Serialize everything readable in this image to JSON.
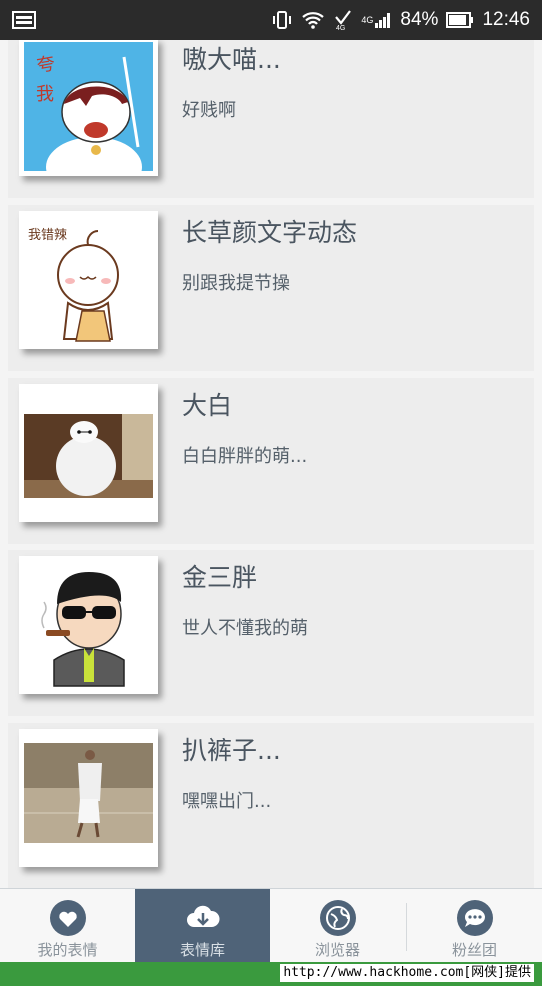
{
  "status_bar": {
    "network": "4G",
    "battery": "84%",
    "time": "12:46"
  },
  "items": [
    {
      "title": "嗷大喵...",
      "subtitle": "好贱啊"
    },
    {
      "title": "长草颜文字动态",
      "subtitle": "别跟我提节操"
    },
    {
      "title": "大白",
      "subtitle": "白白胖胖的萌..."
    },
    {
      "title": "金三胖",
      "subtitle": "世人不懂我的萌"
    },
    {
      "title": "扒裤子...",
      "subtitle": "嘿嘿出门..."
    }
  ],
  "tabs": [
    {
      "label": "我的表情",
      "icon": "heart-icon",
      "active": false
    },
    {
      "label": "表情库",
      "icon": "cloud-download-icon",
      "active": true
    },
    {
      "label": "浏览器",
      "icon": "globe-icon",
      "active": false
    },
    {
      "label": "粉丝团",
      "icon": "chat-bubble-icon",
      "active": false
    }
  ],
  "watermark": "http://www.hackhome.com[网侠]提供",
  "colors": {
    "status_bar": "#2b2b2b",
    "card_bg": "#ededed",
    "tab_active": "#4f6378",
    "footer": "#3a9a3e"
  }
}
